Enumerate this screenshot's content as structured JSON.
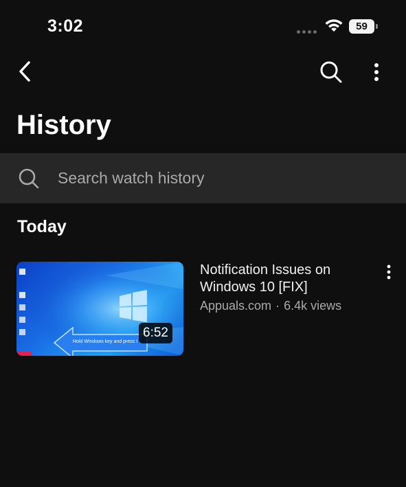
{
  "status_bar": {
    "time": "3:02",
    "battery": "59"
  },
  "top_bar": {
    "back_icon": "back-arrow-icon",
    "search_icon": "search-icon",
    "more_icon": "more-vertical-icon"
  },
  "page": {
    "title": "History"
  },
  "search": {
    "placeholder": "Search watch history",
    "value": ""
  },
  "sections": [
    {
      "heading": "Today",
      "videos": [
        {
          "title": "Notification Issues on Windows 10 [FIX]",
          "channel": "Appuals.com",
          "separator": "·",
          "views": "6.4k views",
          "duration": "6:52",
          "thumbnail_caption": "Hold Windows key and press I"
        }
      ]
    }
  ],
  "colors": {
    "background": "#0f0f0f",
    "search_bar": "#272727",
    "primary_text": "#f1f1f1",
    "secondary_text": "#aaaaaa"
  }
}
